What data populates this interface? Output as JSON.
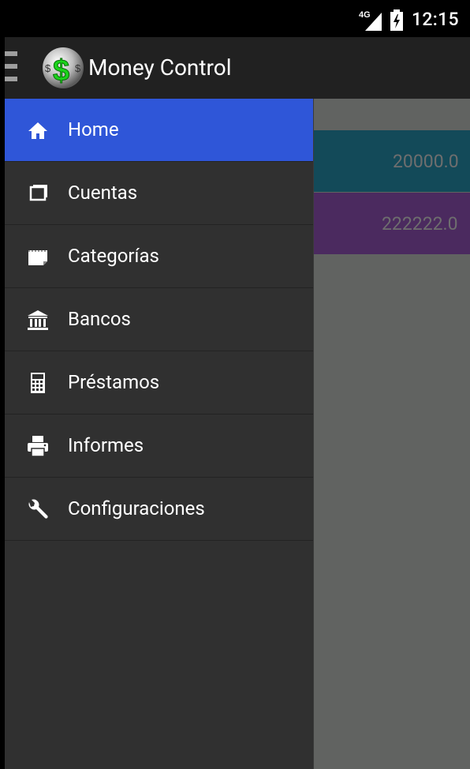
{
  "status_bar": {
    "network": "4G",
    "time": "12:15"
  },
  "action_bar": {
    "title": "Money Control",
    "logo_symbol": "$"
  },
  "background_list": [
    {
      "value": "20000.0",
      "color": "#134a59"
    },
    {
      "value": "222222.0",
      "color": "#4b2a5f"
    }
  ],
  "drawer": {
    "items": [
      {
        "label": "Home",
        "icon": "home-icon",
        "active": true
      },
      {
        "label": "Cuentas",
        "icon": "accounts-icon",
        "active": false
      },
      {
        "label": "Categorías",
        "icon": "categories-icon",
        "active": false
      },
      {
        "label": "Bancos",
        "icon": "bank-icon",
        "active": false
      },
      {
        "label": "Préstamos",
        "icon": "calculator-icon",
        "active": false
      },
      {
        "label": "Informes",
        "icon": "printer-icon",
        "active": false
      },
      {
        "label": "Configuraciones",
        "icon": "wrench-icon",
        "active": false
      }
    ]
  },
  "colors": {
    "accent": "#2f56d8",
    "drawer_bg": "#303030",
    "actionbar_bg": "#212121",
    "logo_dollar": "#1bd31b"
  }
}
